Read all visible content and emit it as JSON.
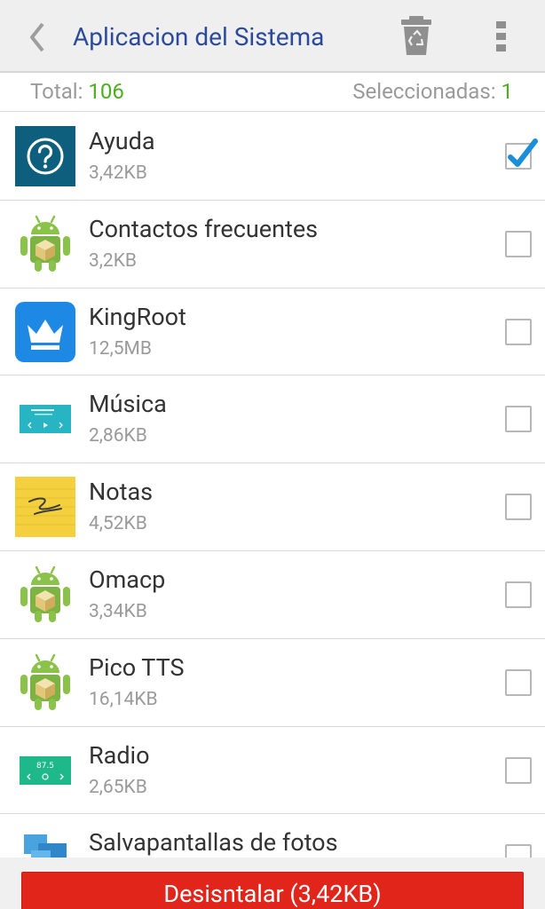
{
  "header": {
    "title": "Aplicacion del Sistema",
    "back_icon": "chevron-left-icon",
    "trash_icon": "recycle-bin-icon",
    "menu_icon": "overflow-menu-icon"
  },
  "summary": {
    "total_label": "Total:",
    "total_value": "106",
    "selected_label": "Seleccionadas:",
    "selected_value": "1"
  },
  "apps": [
    {
      "name": "Ayuda",
      "size": "3,42KB",
      "icon": "help-icon",
      "checked": true
    },
    {
      "name": "Contactos frecuentes",
      "size": "3,2KB",
      "icon": "android-icon",
      "checked": false
    },
    {
      "name": "KingRoot",
      "size": "12,5MB",
      "icon": "kingroot-crown-icon",
      "checked": false
    },
    {
      "name": "Música",
      "size": "2,86KB",
      "icon": "music-widget-icon",
      "checked": false
    },
    {
      "name": "Notas",
      "size": "4,52KB",
      "icon": "notes-icon",
      "checked": false
    },
    {
      "name": "Omacp",
      "size": "3,34KB",
      "icon": "android-icon",
      "checked": false
    },
    {
      "name": "Pico TTS",
      "size": "16,14KB",
      "icon": "android-icon",
      "checked": false
    },
    {
      "name": "Radio",
      "size": "2,65KB",
      "icon": "radio-widget-icon",
      "checked": false
    },
    {
      "name": "Salvapantallas de fotos",
      "size": "",
      "icon": "photo-screensaver-icon",
      "checked": false
    }
  ],
  "radio_icon_text": "87.5",
  "bottom": {
    "uninstall_label": "Desisntalar (3,42KB)"
  },
  "colors": {
    "title": "#2b4a9b",
    "count_green": "#4caf1f",
    "uninstall_red": "#e1251b",
    "check_blue": "#1b8ed8"
  }
}
